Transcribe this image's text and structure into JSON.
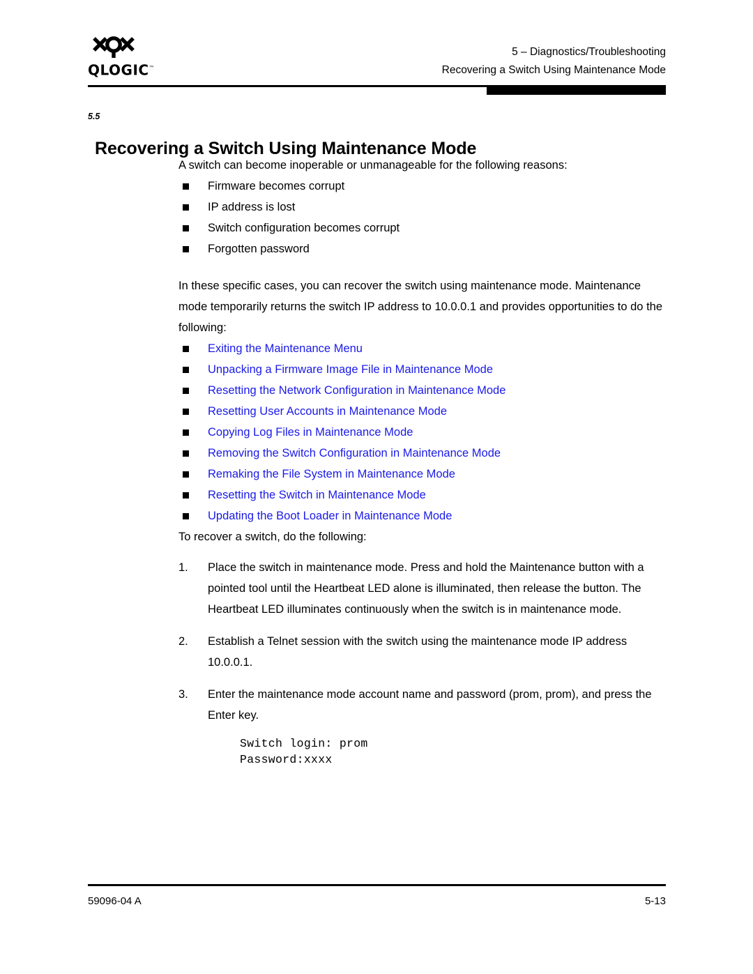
{
  "header": {
    "logo_word": "QLOGIC",
    "logo_tm": "™",
    "chapter": "5 – Diagnostics/Troubleshooting",
    "section": "Recovering a Switch Using Maintenance Mode"
  },
  "section": {
    "number": "5.5",
    "title": "Recovering a Switch Using Maintenance Mode"
  },
  "content": {
    "intro": "A switch can become inoperable or unmanageable for the following reasons:",
    "reasons": [
      "Firmware becomes corrupt",
      "IP address is lost",
      "Switch configuration becomes corrupt",
      "Forgotten password"
    ],
    "explanation": "In these specific cases, you can recover the switch using maintenance mode. Maintenance mode temporarily returns the switch IP address to 10.0.0.1 and provides opportunities to do the following:",
    "links": [
      "Exiting the Maintenance Menu",
      "Unpacking a Firmware Image File in Maintenance Mode",
      "Resetting the Network Configuration in Maintenance Mode",
      "Resetting User Accounts in Maintenance Mode",
      "Copying Log Files in Maintenance Mode",
      "Removing the Switch Configuration in Maintenance Mode",
      "Remaking the File System in Maintenance Mode",
      "Resetting the Switch in Maintenance Mode",
      "Updating the Boot Loader in Maintenance Mode"
    ],
    "steps_lead": "To recover a switch, do the following:",
    "steps": [
      {
        "num": "1.",
        "text": "Place the switch in maintenance mode. Press and hold the Maintenance button with a pointed tool until the Heartbeat LED alone is illuminated, then release the button. The Heartbeat LED illuminates continuously when the switch is in maintenance mode."
      },
      {
        "num": "2.",
        "text": "Establish a Telnet session with the switch using the maintenance mode IP address 10.0.0.1."
      },
      {
        "num": "3.",
        "text": "Enter the maintenance mode account name and password (prom, prom), and press the Enter key."
      }
    ],
    "code": "Switch login: prom\nPassword:xxxx"
  },
  "footer": {
    "doc_id": "59096-04  A",
    "page": "5-13"
  },
  "colors": {
    "link": "#1a1ae8",
    "text": "#000000",
    "background": "#ffffff"
  }
}
